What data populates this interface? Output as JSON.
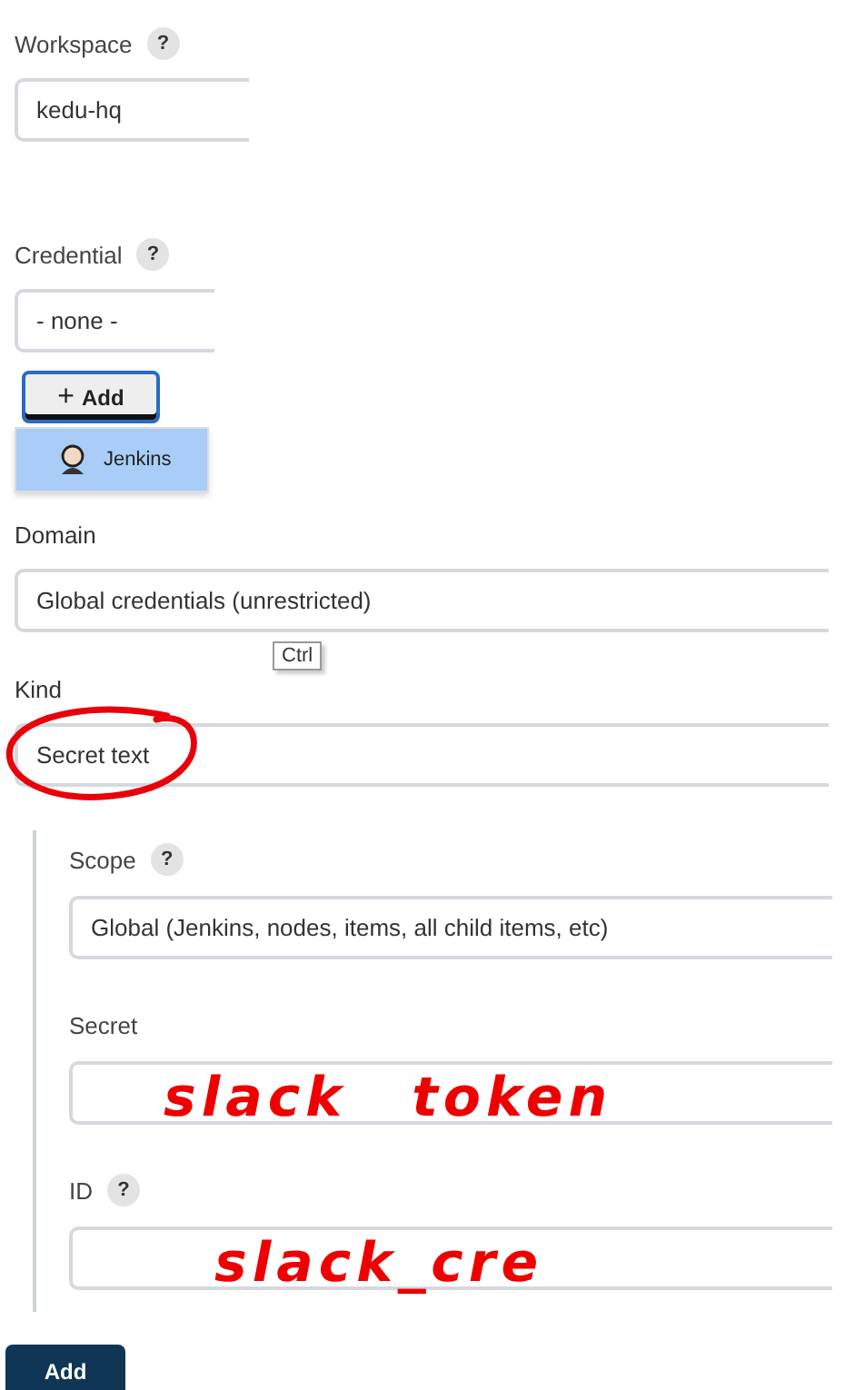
{
  "workspace": {
    "label": "Workspace",
    "help": "?",
    "value": "kedu-hq"
  },
  "credential": {
    "label": "Credential",
    "help": "?",
    "value": "- none -",
    "add_icon": "+",
    "add_button": "Add",
    "menu": [
      {
        "label": "Jenkins",
        "selected": true
      }
    ]
  },
  "dialog": {
    "domain": {
      "label": "Domain",
      "value": "Global credentials (unrestricted)"
    },
    "tooltip": "Ctrl",
    "kind": {
      "label": "Kind",
      "value": "Secret text",
      "circled": true
    },
    "scope": {
      "label": "Scope",
      "help": "?",
      "value": "Global (Jenkins, nodes, items, all child items, etc)"
    },
    "secret": {
      "label": "Secret",
      "annotation": "slack token"
    },
    "id": {
      "label": "ID",
      "help": "?",
      "annotation": "slack_cre"
    },
    "submit": "Add"
  }
}
